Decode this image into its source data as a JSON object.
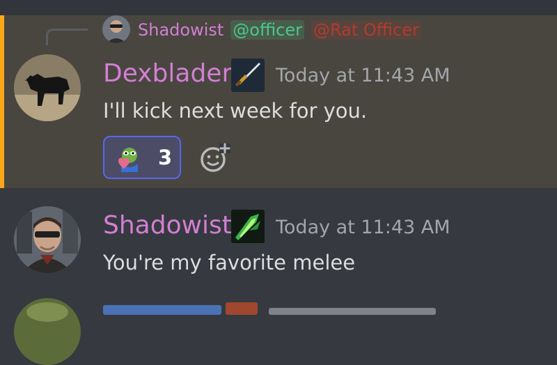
{
  "reply_preview": {
    "author": "Shadowist",
    "mentions": [
      "@officer",
      "@Rat Officer"
    ]
  },
  "messages": [
    {
      "author": "Dexblader",
      "timestamp": "Today at 11:43 AM",
      "text": "I'll kick next week for you.",
      "badge_icon": "sword-badge-icon",
      "reaction": {
        "icon": "pepe-heart-emoji",
        "count": "3"
      }
    },
    {
      "author": "Shadowist",
      "timestamp": "Today at 11:43 AM",
      "text": "You're my favorite melee",
      "badge_icon": "green-blade-badge-icon"
    }
  ],
  "colors": {
    "background": "#36393f",
    "highlight_background": "#494640",
    "highlight_bar": "#faa81a",
    "username": "#d27fd3",
    "officer_mention": "#4ec788",
    "rat_officer_mention": "#b23b2e",
    "reaction_border": "#5865f2"
  }
}
